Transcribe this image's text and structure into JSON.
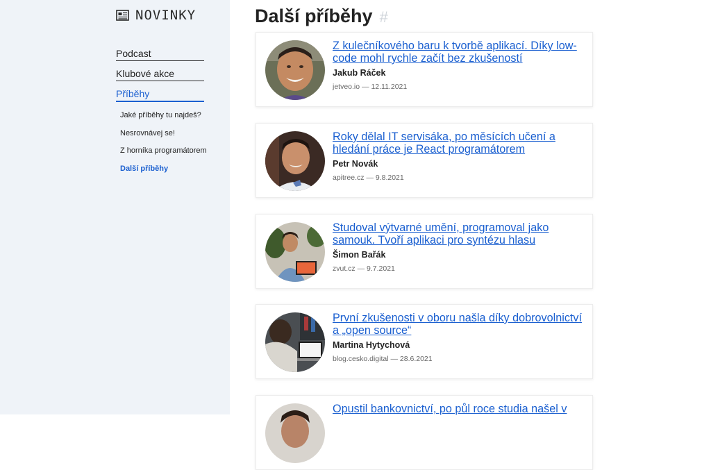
{
  "logo": {
    "text": "NOVINKY",
    "icon": "newspaper-icon"
  },
  "nav": {
    "items": [
      {
        "label": "Podcast"
      },
      {
        "label": "Klubové akce"
      },
      {
        "label": "Příběhy",
        "active": true
      }
    ],
    "sub_items": [
      {
        "label": "Jaké příběhy tu najdeš?"
      },
      {
        "label": "Nesrovnávej se!"
      },
      {
        "label": "Z horníka programátorem"
      },
      {
        "label": "Další příběhy",
        "active": true
      }
    ]
  },
  "main": {
    "title": "Další příběhy",
    "anchor": "#"
  },
  "stories": [
    {
      "title": "Z kulečníkového baru k tvorbě aplikací. Díky low-code mohl rychle začít bez zkušeností",
      "author": "Jakub Ráček",
      "meta": "jetveo.io — 12.11.2021"
    },
    {
      "title": "Roky dělal IT servisáka, po měsících učení a hledání práce je React programátorem",
      "author": "Petr Novák",
      "meta": "apitree.cz — 9.8.2021"
    },
    {
      "title": "Studoval výtvarné umění, programoval jako samouk. Tvoří aplikaci pro syntézu hlasu",
      "author": "Šimon Bařák",
      "meta": "zvut.cz — 9.7.2021"
    },
    {
      "title": "První zkušenosti v oboru našla díky dobrovolnictví a „open source“",
      "author": "Martina Hytychová",
      "meta": "blog.cesko.digital — 28.6.2021"
    },
    {
      "title": "Opustil bankovnictví, po půl roce studia našel v"
    }
  ],
  "colors": {
    "link": "#1a5fd0",
    "sidebar_bg": "#eff3f8"
  }
}
